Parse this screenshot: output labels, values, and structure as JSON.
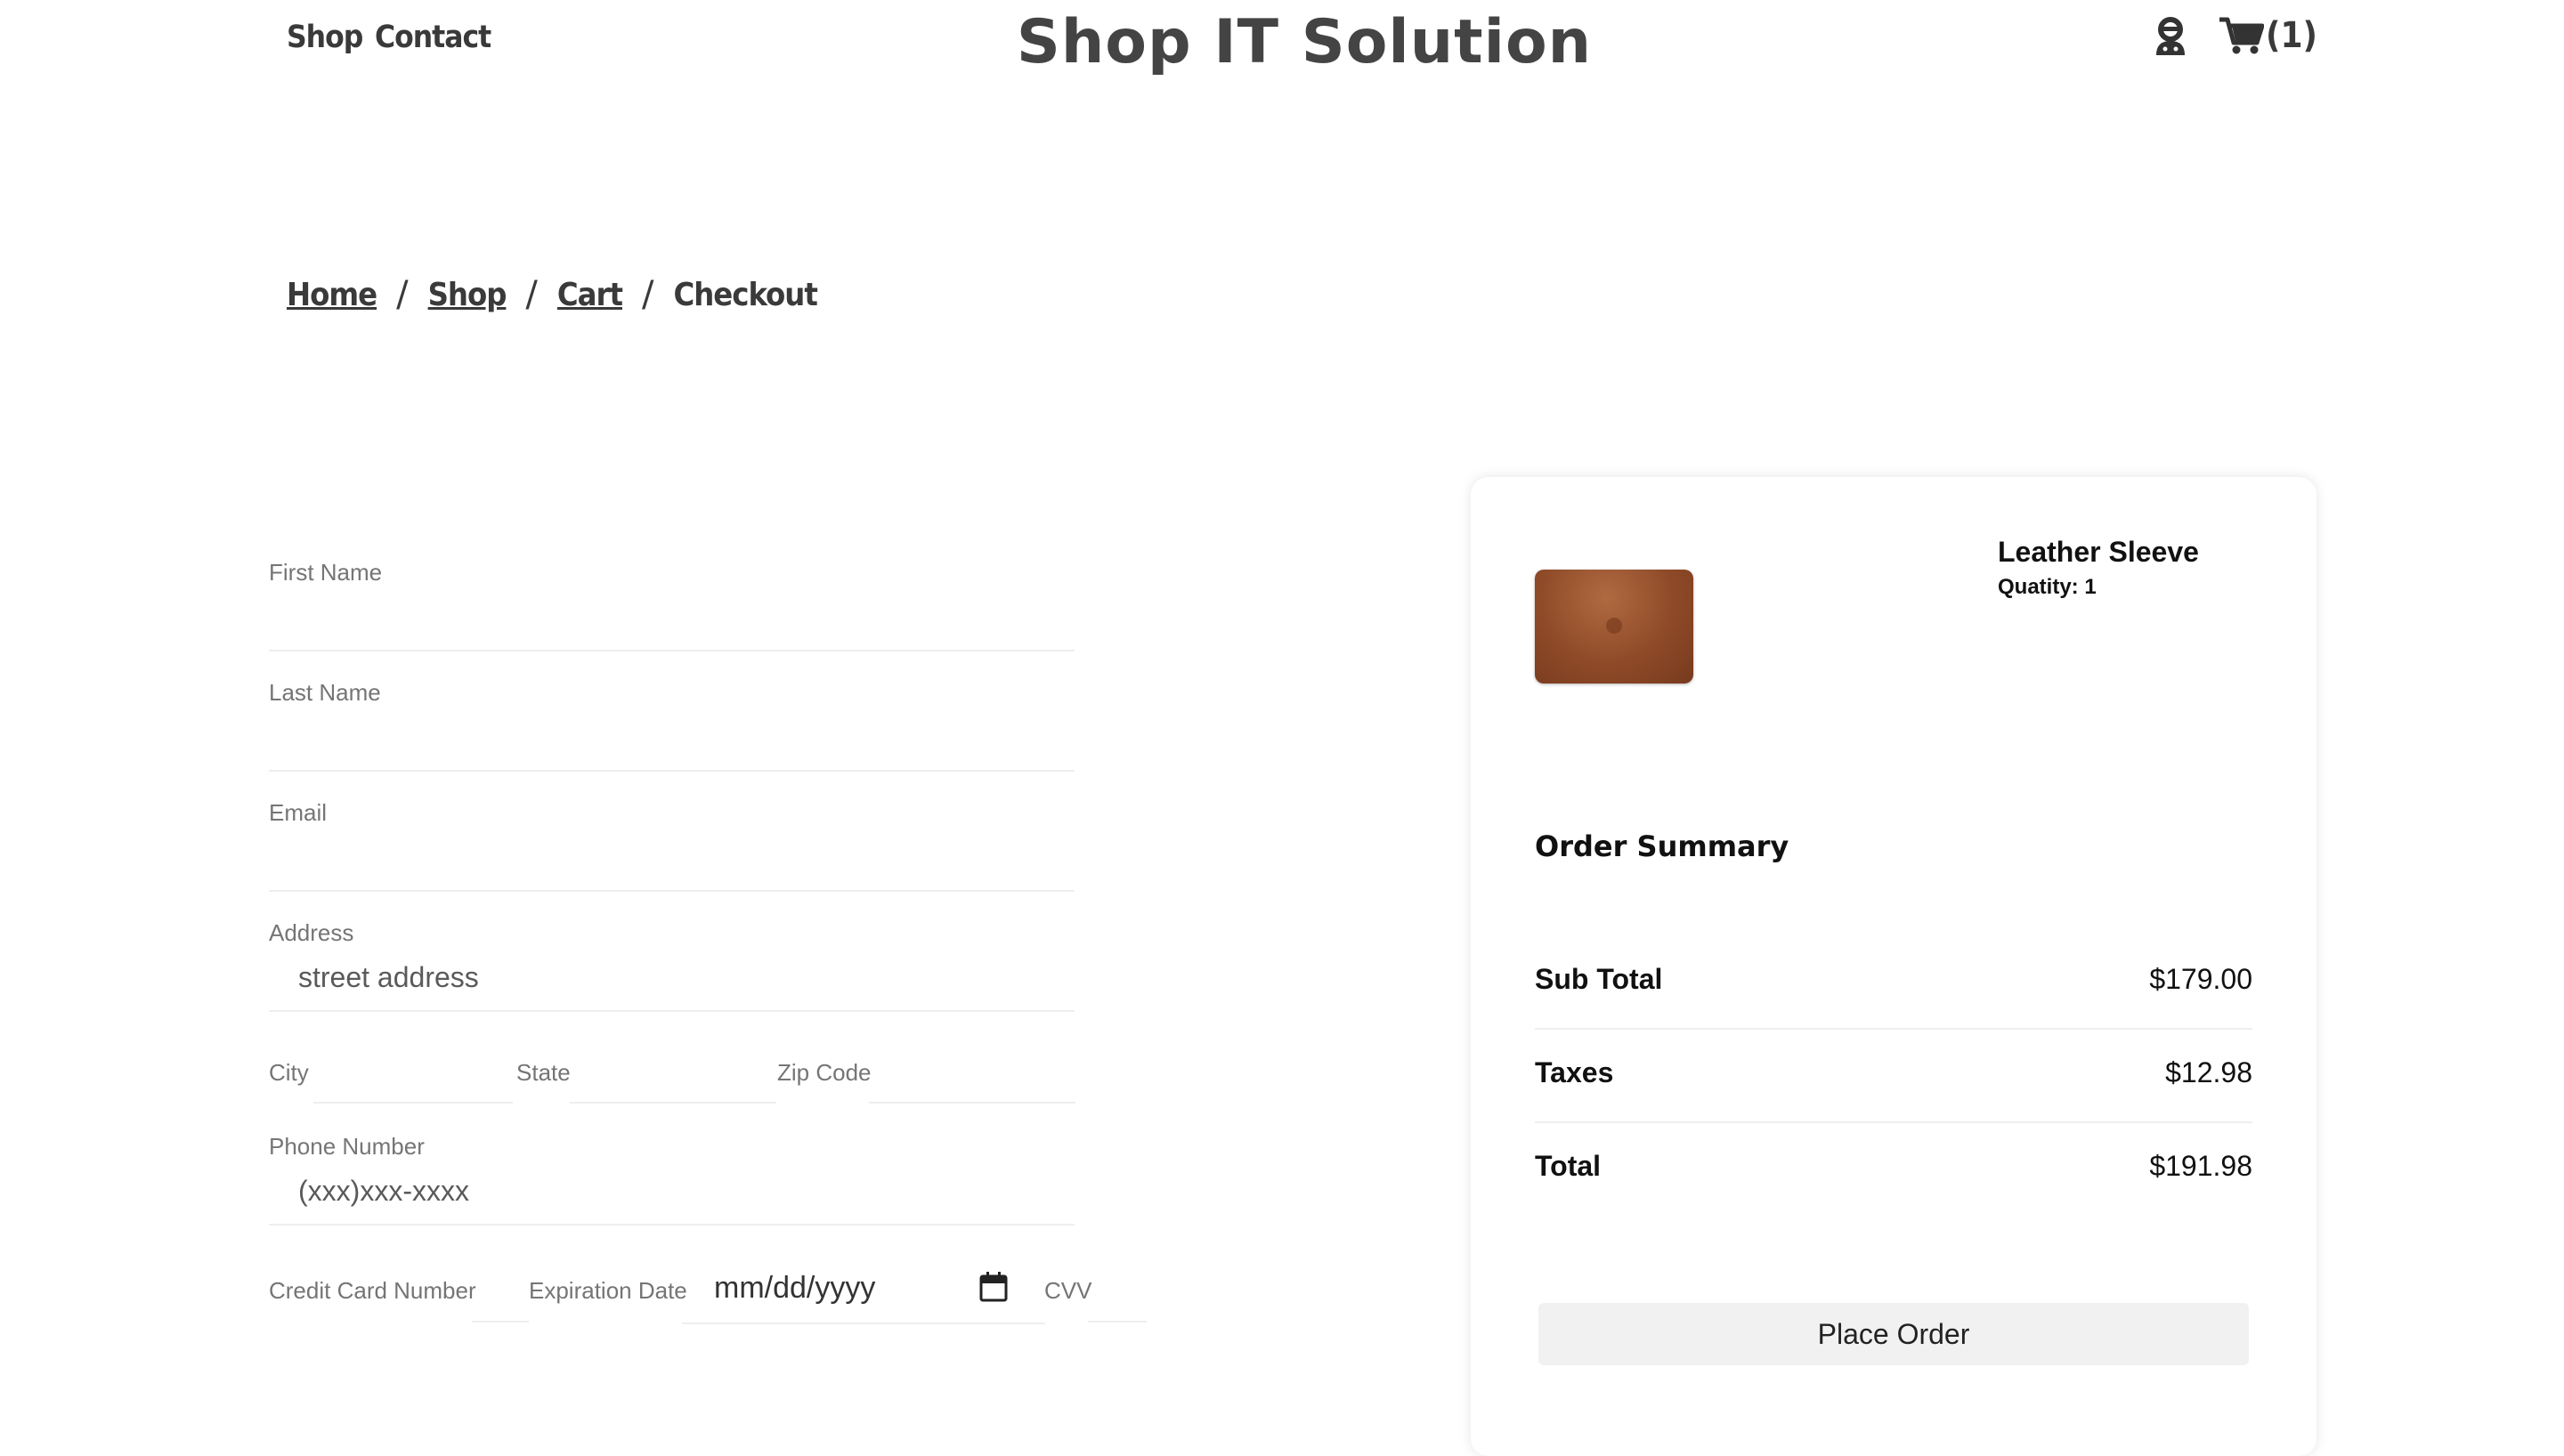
{
  "header": {
    "nav": [
      "Shop",
      "Contact"
    ],
    "brand": "Shop IT Solution",
    "cart_count": "(1)",
    "icons": {
      "account": "user-icon",
      "cart": "cart-icon"
    }
  },
  "breadcrumb": {
    "items": [
      "Home",
      "Shop",
      "Cart",
      "Checkout"
    ],
    "separator": "/"
  },
  "form": {
    "first_name_label": "First Name",
    "last_name_label": "Last Name",
    "email_label": "Email",
    "address_label": "Address",
    "address_placeholder": "street address",
    "city_label": "City",
    "state_label": "State",
    "zip_label": "Zip Code",
    "phone_label": "Phone Number",
    "phone_placeholder": "(xxx)xxx-xxxx",
    "card_number_label": "Credit Card Number",
    "expiration_label": "Expiration Date",
    "expiration_placeholder": "mm/dd/yyyy",
    "cvv_label": "CVV"
  },
  "order": {
    "product": {
      "name": "Leather Sleeve",
      "quantity": "Quatity: 1"
    },
    "summary_title": "Order Summary",
    "rows": [
      {
        "label": "Sub Total",
        "value": "$179.00"
      },
      {
        "label": "Taxes",
        "value": "$12.98"
      },
      {
        "label": "Total",
        "value": "$191.98"
      }
    ],
    "place_order": "Place Order"
  },
  "colors": {
    "text_dark": "#333333",
    "label_gray": "#757575",
    "divider": "#eeeeee",
    "button_bg": "#f1f1f1",
    "product_brown": "#8e4a28"
  }
}
